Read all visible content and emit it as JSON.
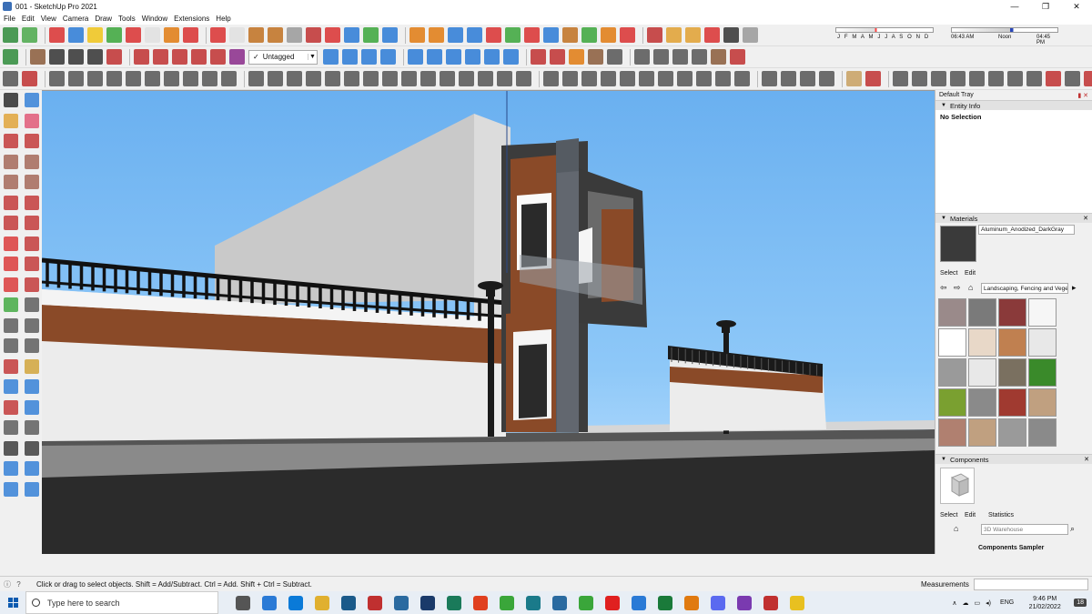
{
  "window": {
    "title": "001 - SketchUp Pro 2021",
    "controls": [
      "—",
      "❐",
      "✕"
    ]
  },
  "menu": [
    "File",
    "Edit",
    "View",
    "Camera",
    "Draw",
    "Tools",
    "Window",
    "Extensions",
    "Help"
  ],
  "toolbar": {
    "layer_selected": "Untagged",
    "shadow_months": "J F M A M J J A S O N D",
    "shadow_time_start": "06:43 AM",
    "shadow_time_mid": "Noon",
    "shadow_time_end": "04:45 PM"
  },
  "toolbar_icons": {
    "row1": [
      "#2e8b3a",
      "#4aa84a",
      "#d93030",
      "#2a7ad6",
      "#f0c419",
      "#3aa63a",
      "#d93030",
      "#e0e0e0",
      "#e07a10",
      "#d93030",
      "#d93030",
      "#e0e0e0",
      "#c07020",
      "#c07020",
      "#999",
      "#c03030",
      "#d93030",
      "#2a7ad6",
      "#3aa63a",
      "#2a7ad6",
      "#e07a10",
      "#e07a10",
      "#2a7ad6",
      "#2a7ad6",
      "#d93030",
      "#3aa63a",
      "#d93030",
      "#2a7ad6",
      "#c07020",
      "#3aa63a",
      "#e07a10",
      "#d93030",
      "#c03030",
      "#e0a030",
      "#e0a030",
      "#d93030",
      "#333",
      "#999"
    ],
    "row2": [
      "#2e8b3a",
      "#8a5a3a",
      "#333",
      "#333",
      "#333",
      "#c03030",
      "#c03030",
      "#c03030",
      "#c03030",
      "#c03030",
      "#c03030",
      "#8a2a8a"
    ],
    "row2b": [
      "#2a7ad6",
      "#2a7ad6",
      "#2a7ad6",
      "#2a7ad6",
      "#2a7ad6",
      "#2a7ad6",
      "#2a7ad6",
      "#2a7ad6",
      "#2a7ad6",
      "#2a7ad6",
      "#c03030",
      "#c03030",
      "#e07a10",
      "#8a5a3a",
      "#555",
      "#555",
      "#555",
      "#555",
      "#555",
      "#8a5a3a",
      "#c03030"
    ],
    "row3": [
      "#555",
      "#c03030",
      "#555",
      "#555",
      "#555",
      "#555",
      "#555",
      "#555",
      "#555",
      "#555",
      "#555",
      "#555",
      "#555",
      "#555",
      "#555",
      "#555",
      "#555",
      "#555",
      "#555",
      "#555",
      "#555",
      "#555",
      "#555",
      "#555",
      "#555",
      "#555",
      "#555",
      "#555",
      "#555",
      "#555",
      "#555",
      "#555",
      "#555",
      "#555",
      "#555",
      "#555",
      "#555",
      "#555",
      "#555",
      "#555",
      "#555",
      "#555",
      "#c8a060",
      "#c03030",
      "#555",
      "#555",
      "#555",
      "#555",
      "#555",
      "#555",
      "#555",
      "#555",
      "#c03030",
      "#555",
      "#c03030",
      "#c03030"
    ]
  },
  "left_tools": [
    [
      "select-tool-icon",
      "#222",
      "component-tool-icon",
      "#2a7ad6"
    ],
    [
      "paint-bucket-icon",
      "#e0a030",
      "eraser-icon",
      "#e05070"
    ],
    [
      "line-tool-icon",
      "#c03030",
      "freehand-tool-icon",
      "#c03030"
    ],
    [
      "rectangle-tool-icon",
      "#a06050",
      "rotated-rectangle-icon",
      "#a06050"
    ],
    [
      "circle-tool-icon",
      "#a06050",
      "polygon-tool-icon",
      "#a06050"
    ],
    [
      "arc-tool-icon",
      "#c03030",
      "two-point-arc-icon",
      "#c03030"
    ],
    [
      "three-point-arc-icon",
      "#c03030",
      "pie-tool-icon",
      "#c03030"
    ],
    [
      "move-tool-icon",
      "#d93030",
      "push-pull-icon",
      "#c03030"
    ],
    [
      "rotate-tool-icon",
      "#d93030",
      "follow-me-icon",
      "#c03030"
    ],
    [
      "scale-tool-icon",
      "#d93030",
      "offset-tool-icon",
      "#c03030"
    ],
    [
      "tape-measure-icon",
      "#3aa63a",
      "dimension-tool-icon",
      "#555"
    ],
    [
      "protractor-icon",
      "#555",
      "text-tool-icon",
      "#555"
    ],
    [
      "axes-tool-icon",
      "#555",
      "3d-text-icon",
      "#555"
    ],
    [
      "orbit-tool-icon",
      "#c03030",
      "pan-tool-icon",
      "#d0a030"
    ],
    [
      "zoom-tool-icon",
      "#2a7ad6",
      "zoom-window-icon",
      "#2a7ad6"
    ],
    [
      "zoom-extents-icon",
      "#c03030",
      "previous-view-icon",
      "#2a7ad6"
    ],
    [
      "position-camera-icon",
      "#555",
      "look-around-icon",
      "#555"
    ],
    [
      "walk-tool-icon",
      "#333",
      "section-plane-icon",
      "#333"
    ],
    [
      "sandbox-contours-icon",
      "#2a7ad6",
      "sandbox-scratch-icon",
      "#2a7ad6"
    ],
    [
      "sandbox-smoove-icon",
      "#2a7ad6",
      "sandbox-stamp-icon",
      "#2a7ad6"
    ]
  ],
  "tray": {
    "title": "Default Tray",
    "entity_info": {
      "title": "Entity Info",
      "selection": "No Selection"
    },
    "materials": {
      "title": "Materials",
      "current_name": "Aluminum_Anodized_DarkGray",
      "tabs": [
        "Select",
        "Edit"
      ],
      "library": "Landscaping, Fencing and Vegetation",
      "swatches": [
        "#9a8a8a",
        "#7a7a7a",
        "#8a3a3a",
        "#f6f6f6",
        "#ffffff",
        "#e8d8c8",
        "#c08050",
        "#e8e8e8",
        "#9a9a9a",
        "#e8e8e8",
        "#7a7060",
        "#3a8a2a",
        "#7aa030",
        "#8a8a8a",
        "#a03a30",
        "#c0a080",
        "#b08070",
        "#c0a080",
        "#9a9a9a",
        "#8a8a8a"
      ]
    },
    "components": {
      "title": "Components",
      "tabs": [
        "Select",
        "Edit",
        "Statistics"
      ],
      "search_placeholder": "3D Warehouse",
      "sampler": "Components Sampler"
    }
  },
  "status": {
    "message": "Click or drag to select objects. Shift = Add/Subtract. Ctrl = Add. Shift + Ctrl = Subtract.",
    "measurements_label": "Measurements"
  },
  "taskbar": {
    "search_placeholder": "Type here to search",
    "apps": [
      "#555",
      "#2a7ad6",
      "#0a7ad8",
      "#e0b030",
      "#1a5a8a",
      "#c03030",
      "#2a6aa0",
      "#1a3a6a",
      "#1a7a5a",
      "#e04020",
      "#3aa63a",
      "#1a7a8a",
      "#2a6aa0",
      "#3aa63a",
      "#e02020",
      "#2a7ad6",
      "#1a7a3a",
      "#e07a10",
      "#5a6af0",
      "#7a3ab0",
      "#c03030",
      "#e8c020"
    ],
    "language": "ENG",
    "time": "9:46 PM",
    "date": "21/02/2022",
    "notification_count": "18"
  },
  "colors": {
    "sky_top": "#6ab0f0",
    "sky_bottom": "#c9e6ff",
    "road": "#2b2b2b",
    "wall": "#e8e8e8",
    "wood": "#8a4a28",
    "dark_frame": "#3c3c3c"
  }
}
